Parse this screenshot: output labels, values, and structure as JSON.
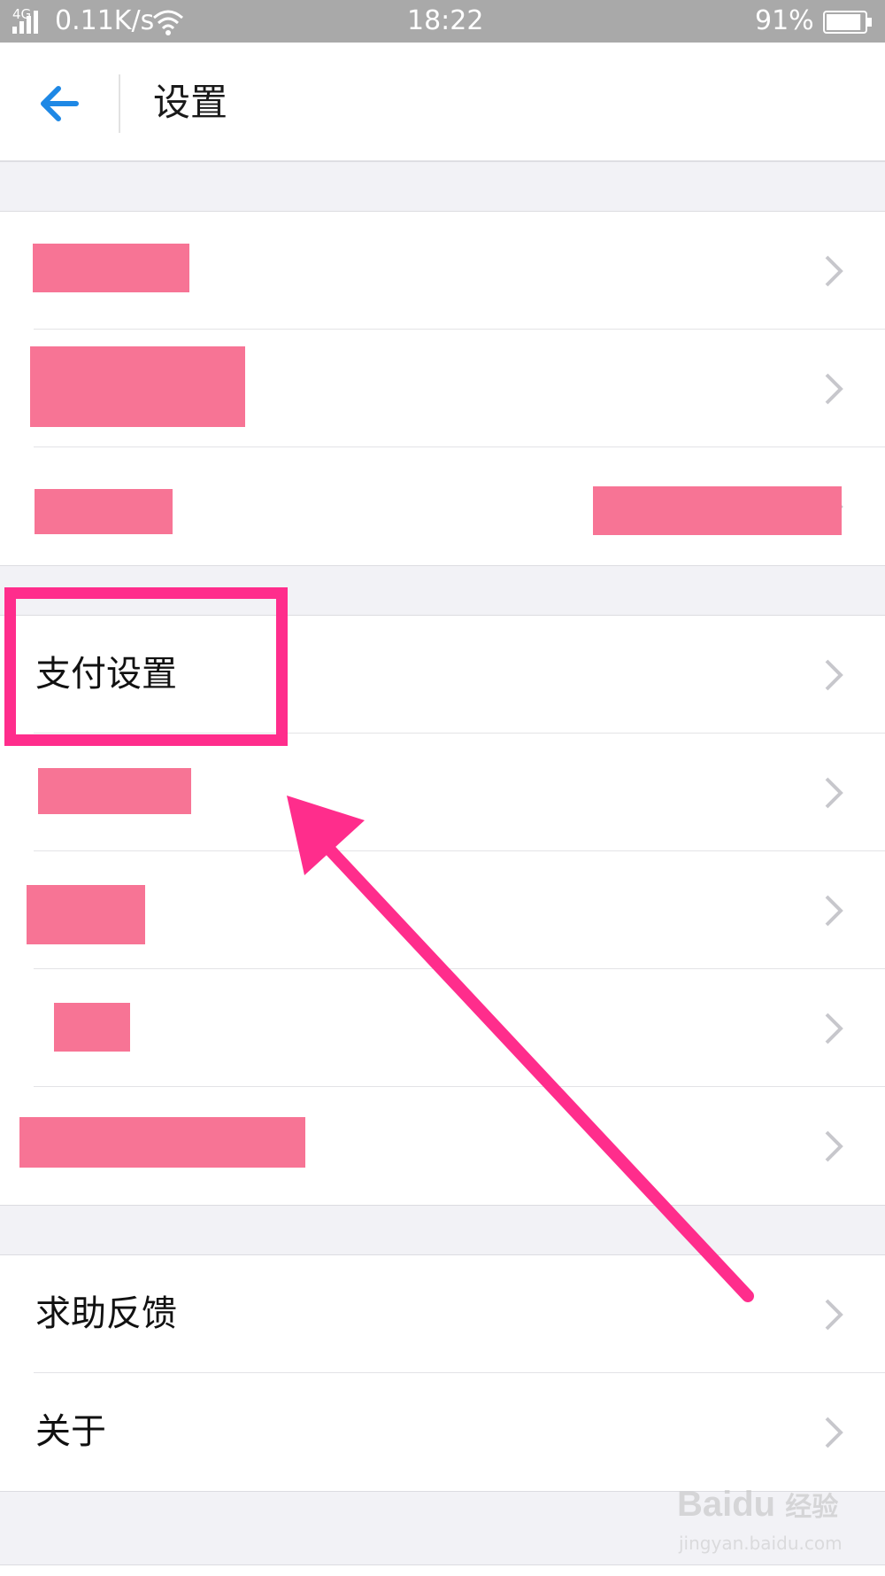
{
  "status_bar": {
    "network": "4G",
    "speed": "0.11K/s",
    "time": "18:22",
    "battery": "91%",
    "battery_level": 0.91
  },
  "header": {
    "title": "设置"
  },
  "groups": [
    {
      "rows": [
        {
          "label": ""
        },
        {
          "label": ""
        },
        {
          "label": ""
        }
      ]
    },
    {
      "rows": [
        {
          "label": "支付设置"
        },
        {
          "label": ""
        },
        {
          "label": ""
        },
        {
          "label": ""
        },
        {
          "label": ""
        }
      ]
    },
    {
      "rows": [
        {
          "label": "求助反馈"
        },
        {
          "label": "关于"
        }
      ]
    }
  ],
  "watermark": {
    "brand": "Bai",
    "brand_cn": "经验",
    "url": "jingyan.baidu.com"
  },
  "colors": {
    "accent_blue": "#1e88e5",
    "highlight_pink": "#ff2d8c",
    "redaction": "#f77495"
  }
}
